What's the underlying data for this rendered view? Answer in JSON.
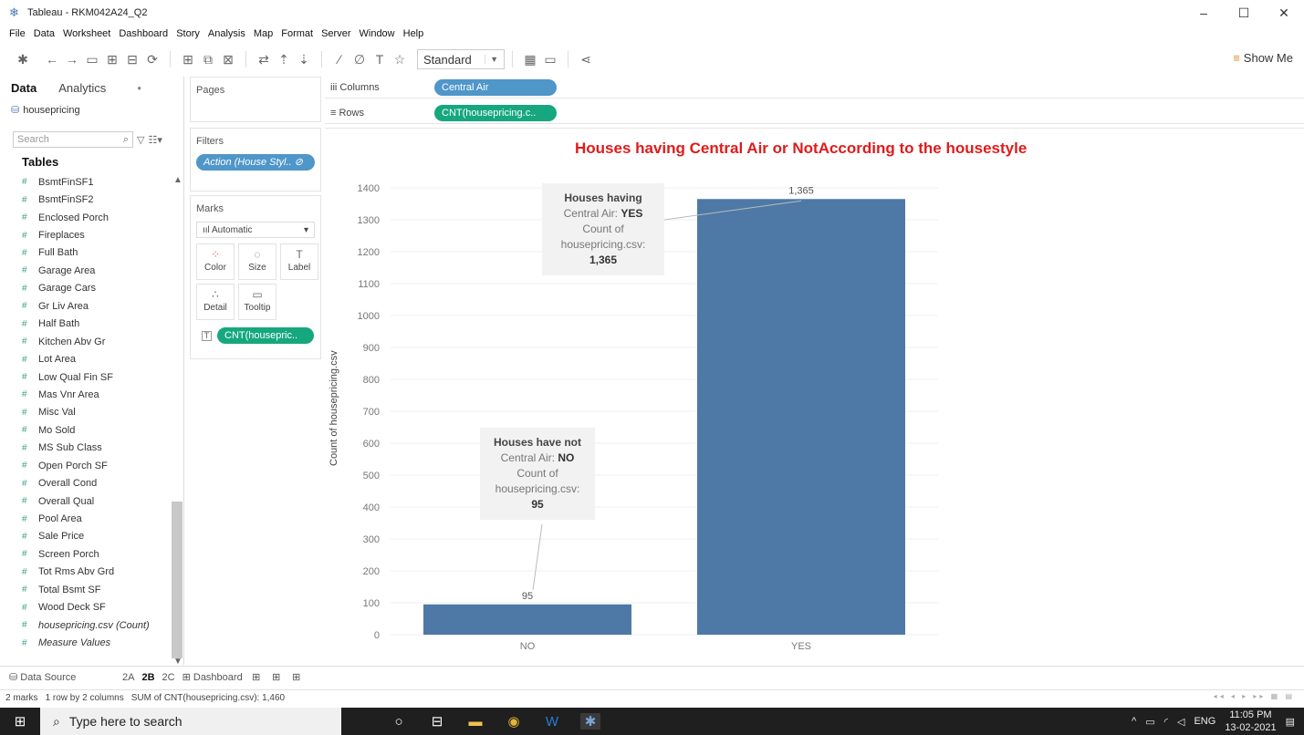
{
  "window": {
    "title": "Tableau - RKM042A24_Q2",
    "controls": [
      "–",
      "☐",
      "✕"
    ]
  },
  "menu": [
    "File",
    "Data",
    "Worksheet",
    "Dashboard",
    "Story",
    "Analysis",
    "Map",
    "Format",
    "Server",
    "Window",
    "Help"
  ],
  "toolbar": {
    "fit_select": "Standard",
    "show_me": "Show Me"
  },
  "left_pane": {
    "tabs": [
      "Data",
      "Analytics"
    ],
    "datasource": "housepricing",
    "search_placeholder": "Search",
    "tables_heading": "Tables",
    "fields": [
      "BsmtFinSF1",
      "BsmtFinSF2",
      "Enclosed Porch",
      "Fireplaces",
      "Full Bath",
      "Garage Area",
      "Garage Cars",
      "Gr Liv Area",
      "Half Bath",
      "Kitchen Abv Gr",
      "Lot Area",
      "Low Qual Fin SF",
      "Mas Vnr Area",
      "Misc Val",
      "Mo Sold",
      "MS Sub Class",
      "Open Porch SF",
      "Overall Cond",
      "Overall Qual",
      "Pool Area",
      "Sale Price",
      "Screen Porch",
      "Tot Rms Abv Grd",
      "Total Bsmt SF",
      "Wood Deck SF",
      "housepricing.csv (Count)",
      "Measure Values"
    ]
  },
  "cards": {
    "pages": "Pages",
    "filters": "Filters",
    "filter_pill": "Action (House Styl..",
    "marks": "Marks",
    "mark_type": "Automatic",
    "mark_buttons": [
      "Color",
      "Size",
      "Label",
      "Detail",
      "Tooltip"
    ],
    "marks_pill": "CNT(housepric.."
  },
  "shelves": {
    "columns_label": "Columns",
    "columns_pill": "Central Air",
    "rows_label": "Rows",
    "rows_pill": "CNT(housepricing.c.."
  },
  "chart_data": {
    "type": "bar",
    "title": "Houses having Central Air or NotAccording to the housestyle",
    "xlabel": "",
    "ylabel": "Count of housepricing.csv",
    "categories": [
      "NO",
      "YES"
    ],
    "values": [
      95,
      1365
    ],
    "data_labels": [
      "95",
      "1,365"
    ],
    "ylim": [
      0,
      1460
    ],
    "yticks": [
      0,
      100,
      200,
      300,
      400,
      500,
      600,
      700,
      800,
      900,
      1000,
      1100,
      1200,
      1300,
      1400
    ],
    "grid": true,
    "color": "#4e79a7",
    "annotations": [
      {
        "heading": "Houses have not",
        "line1_label": "Central Air:",
        "line1_value": "NO",
        "line2": "Count of",
        "line3": "housepricing.csv:",
        "value": "95"
      },
      {
        "heading": "Houses having",
        "line1_label": "Central Air:",
        "line1_value": "YES",
        "line2": "Count of",
        "line3": "housepricing.csv:",
        "value": "1,365"
      }
    ]
  },
  "sheet_tabs": {
    "data_source": "Data Source",
    "sheets": [
      "2A",
      "2B",
      "2C"
    ],
    "active": "2B",
    "dashboard": "Dashboard"
  },
  "status": {
    "marks": "2 marks",
    "dims": "1 row by 2 columns",
    "sum": "SUM of CNT(housepricing.csv): 1,460"
  },
  "taskbar": {
    "search_placeholder": "Type here to search",
    "lang": "ENG",
    "time": "11:05 PM",
    "date": "13-02-2021"
  }
}
